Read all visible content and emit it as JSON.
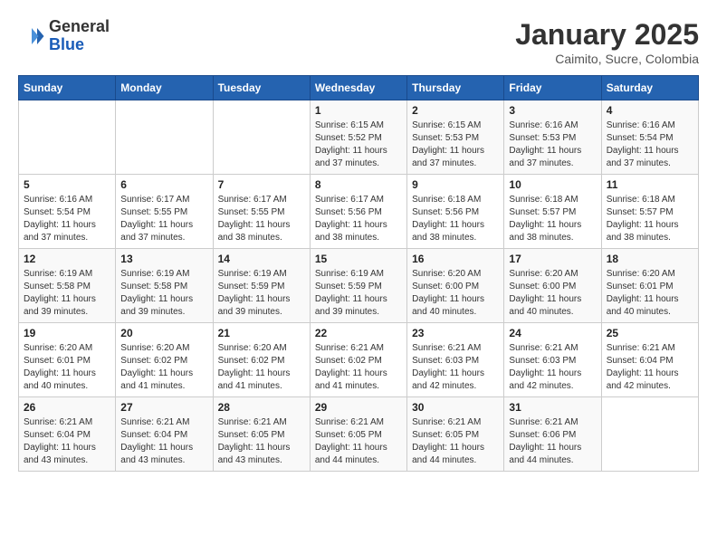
{
  "header": {
    "logo_line1": "General",
    "logo_line2": "Blue",
    "month": "January 2025",
    "location": "Caimito, Sucre, Colombia"
  },
  "weekdays": [
    "Sunday",
    "Monday",
    "Tuesday",
    "Wednesday",
    "Thursday",
    "Friday",
    "Saturday"
  ],
  "weeks": [
    [
      {
        "day": "",
        "sunrise": "",
        "sunset": "",
        "daylight": ""
      },
      {
        "day": "",
        "sunrise": "",
        "sunset": "",
        "daylight": ""
      },
      {
        "day": "",
        "sunrise": "",
        "sunset": "",
        "daylight": ""
      },
      {
        "day": "1",
        "sunrise": "Sunrise: 6:15 AM",
        "sunset": "Sunset: 5:52 PM",
        "daylight": "Daylight: 11 hours and 37 minutes."
      },
      {
        "day": "2",
        "sunrise": "Sunrise: 6:15 AM",
        "sunset": "Sunset: 5:53 PM",
        "daylight": "Daylight: 11 hours and 37 minutes."
      },
      {
        "day": "3",
        "sunrise": "Sunrise: 6:16 AM",
        "sunset": "Sunset: 5:53 PM",
        "daylight": "Daylight: 11 hours and 37 minutes."
      },
      {
        "day": "4",
        "sunrise": "Sunrise: 6:16 AM",
        "sunset": "Sunset: 5:54 PM",
        "daylight": "Daylight: 11 hours and 37 minutes."
      }
    ],
    [
      {
        "day": "5",
        "sunrise": "Sunrise: 6:16 AM",
        "sunset": "Sunset: 5:54 PM",
        "daylight": "Daylight: 11 hours and 37 minutes."
      },
      {
        "day": "6",
        "sunrise": "Sunrise: 6:17 AM",
        "sunset": "Sunset: 5:55 PM",
        "daylight": "Daylight: 11 hours and 37 minutes."
      },
      {
        "day": "7",
        "sunrise": "Sunrise: 6:17 AM",
        "sunset": "Sunset: 5:55 PM",
        "daylight": "Daylight: 11 hours and 38 minutes."
      },
      {
        "day": "8",
        "sunrise": "Sunrise: 6:17 AM",
        "sunset": "Sunset: 5:56 PM",
        "daylight": "Daylight: 11 hours and 38 minutes."
      },
      {
        "day": "9",
        "sunrise": "Sunrise: 6:18 AM",
        "sunset": "Sunset: 5:56 PM",
        "daylight": "Daylight: 11 hours and 38 minutes."
      },
      {
        "day": "10",
        "sunrise": "Sunrise: 6:18 AM",
        "sunset": "Sunset: 5:57 PM",
        "daylight": "Daylight: 11 hours and 38 minutes."
      },
      {
        "day": "11",
        "sunrise": "Sunrise: 6:18 AM",
        "sunset": "Sunset: 5:57 PM",
        "daylight": "Daylight: 11 hours and 38 minutes."
      }
    ],
    [
      {
        "day": "12",
        "sunrise": "Sunrise: 6:19 AM",
        "sunset": "Sunset: 5:58 PM",
        "daylight": "Daylight: 11 hours and 39 minutes."
      },
      {
        "day": "13",
        "sunrise": "Sunrise: 6:19 AM",
        "sunset": "Sunset: 5:58 PM",
        "daylight": "Daylight: 11 hours and 39 minutes."
      },
      {
        "day": "14",
        "sunrise": "Sunrise: 6:19 AM",
        "sunset": "Sunset: 5:59 PM",
        "daylight": "Daylight: 11 hours and 39 minutes."
      },
      {
        "day": "15",
        "sunrise": "Sunrise: 6:19 AM",
        "sunset": "Sunset: 5:59 PM",
        "daylight": "Daylight: 11 hours and 39 minutes."
      },
      {
        "day": "16",
        "sunrise": "Sunrise: 6:20 AM",
        "sunset": "Sunset: 6:00 PM",
        "daylight": "Daylight: 11 hours and 40 minutes."
      },
      {
        "day": "17",
        "sunrise": "Sunrise: 6:20 AM",
        "sunset": "Sunset: 6:00 PM",
        "daylight": "Daylight: 11 hours and 40 minutes."
      },
      {
        "day": "18",
        "sunrise": "Sunrise: 6:20 AM",
        "sunset": "Sunset: 6:01 PM",
        "daylight": "Daylight: 11 hours and 40 minutes."
      }
    ],
    [
      {
        "day": "19",
        "sunrise": "Sunrise: 6:20 AM",
        "sunset": "Sunset: 6:01 PM",
        "daylight": "Daylight: 11 hours and 40 minutes."
      },
      {
        "day": "20",
        "sunrise": "Sunrise: 6:20 AM",
        "sunset": "Sunset: 6:02 PM",
        "daylight": "Daylight: 11 hours and 41 minutes."
      },
      {
        "day": "21",
        "sunrise": "Sunrise: 6:20 AM",
        "sunset": "Sunset: 6:02 PM",
        "daylight": "Daylight: 11 hours and 41 minutes."
      },
      {
        "day": "22",
        "sunrise": "Sunrise: 6:21 AM",
        "sunset": "Sunset: 6:02 PM",
        "daylight": "Daylight: 11 hours and 41 minutes."
      },
      {
        "day": "23",
        "sunrise": "Sunrise: 6:21 AM",
        "sunset": "Sunset: 6:03 PM",
        "daylight": "Daylight: 11 hours and 42 minutes."
      },
      {
        "day": "24",
        "sunrise": "Sunrise: 6:21 AM",
        "sunset": "Sunset: 6:03 PM",
        "daylight": "Daylight: 11 hours and 42 minutes."
      },
      {
        "day": "25",
        "sunrise": "Sunrise: 6:21 AM",
        "sunset": "Sunset: 6:04 PM",
        "daylight": "Daylight: 11 hours and 42 minutes."
      }
    ],
    [
      {
        "day": "26",
        "sunrise": "Sunrise: 6:21 AM",
        "sunset": "Sunset: 6:04 PM",
        "daylight": "Daylight: 11 hours and 43 minutes."
      },
      {
        "day": "27",
        "sunrise": "Sunrise: 6:21 AM",
        "sunset": "Sunset: 6:04 PM",
        "daylight": "Daylight: 11 hours and 43 minutes."
      },
      {
        "day": "28",
        "sunrise": "Sunrise: 6:21 AM",
        "sunset": "Sunset: 6:05 PM",
        "daylight": "Daylight: 11 hours and 43 minutes."
      },
      {
        "day": "29",
        "sunrise": "Sunrise: 6:21 AM",
        "sunset": "Sunset: 6:05 PM",
        "daylight": "Daylight: 11 hours and 44 minutes."
      },
      {
        "day": "30",
        "sunrise": "Sunrise: 6:21 AM",
        "sunset": "Sunset: 6:05 PM",
        "daylight": "Daylight: 11 hours and 44 minutes."
      },
      {
        "day": "31",
        "sunrise": "Sunrise: 6:21 AM",
        "sunset": "Sunset: 6:06 PM",
        "daylight": "Daylight: 11 hours and 44 minutes."
      },
      {
        "day": "",
        "sunrise": "",
        "sunset": "",
        "daylight": ""
      }
    ]
  ]
}
